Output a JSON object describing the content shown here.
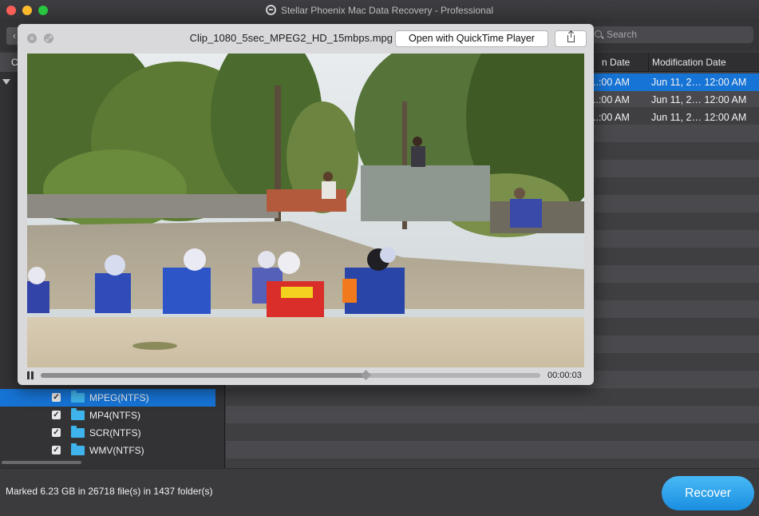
{
  "window": {
    "title": "Stellar Phoenix Mac Data Recovery - Professional"
  },
  "toolbar": {
    "back_label": "‹",
    "search_placeholder": "Search"
  },
  "list_header": {
    "left_col": "C",
    "creation_date": "n Date",
    "modification_date": "Modification Date"
  },
  "tree": {
    "items": [
      {
        "label": "MPEG(NTFS)",
        "checked": true,
        "selected": true
      },
      {
        "label": "MP4(NTFS)",
        "checked": true,
        "selected": false
      },
      {
        "label": "SCR(NTFS)",
        "checked": true,
        "selected": false
      },
      {
        "label": "WMV(NTFS)",
        "checked": true,
        "selected": false
      }
    ],
    "check_glyph": "✓"
  },
  "files": {
    "rows": [
      {
        "creation": "..:00 AM",
        "modification": "Jun 11, 2… 12:00 AM",
        "selected": true
      },
      {
        "creation": "..:00 AM",
        "modification": "Jun 11, 2… 12:00 AM",
        "selected": false
      },
      {
        "creation": "..:00 AM",
        "modification": "Jun 11, 2… 12:00 AM",
        "selected": false
      }
    ]
  },
  "status": {
    "text": "Marked 6.23 GB in 26718 file(s) in 1437 folder(s)"
  },
  "actions": {
    "recover_label": "Recover"
  },
  "quicklook": {
    "filename": "Clip_1080_5sec_MPEG2_HD_15mbps.mpg",
    "open_button_label": "Open with QuickTime Player",
    "close_glyph": "×",
    "fullscreen_glyph": "⤢",
    "time": "00:00:03",
    "progress": 0.65
  },
  "colors": {
    "selection": "#1674d6",
    "recover_button": "#2a9de8",
    "folder": "#3fb4ec"
  },
  "icons": [
    "app-logo-icon",
    "search-icon",
    "disclosure-triangle-icon",
    "folder-icon",
    "checkbox-icon",
    "close-icon",
    "fullscreen-icon",
    "share-icon",
    "pause-icon"
  ]
}
